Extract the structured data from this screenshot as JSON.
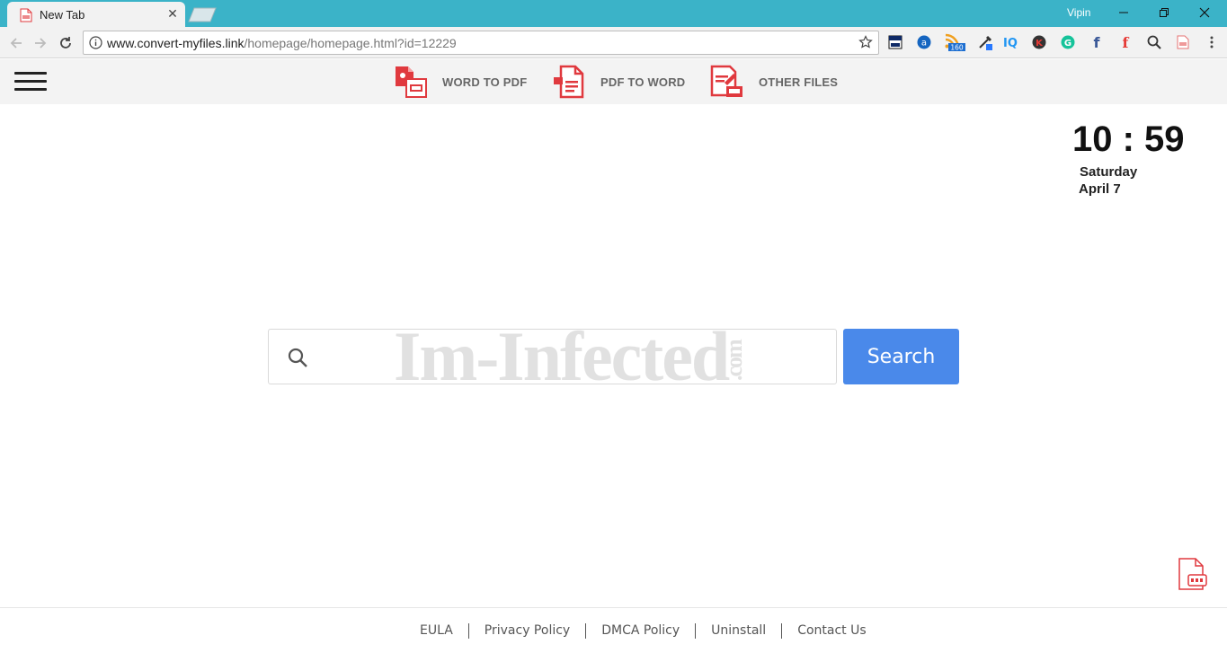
{
  "browser": {
    "tab_title": "New Tab",
    "tab_close": "✕",
    "profile_name": "Vipin",
    "url_host": "www.convert-myfiles.link",
    "url_path": "/homepage/homepage.html?id=12229",
    "extensions": [
      "window-icon",
      "a-icon",
      "rss-icon",
      "eyedropper-icon",
      "iq-icon",
      "k-icon",
      "grammarly-icon",
      "facebook-icon",
      "flipboard-icon",
      "magnifier-icon",
      "pdf-icon"
    ],
    "rss_badge": "160",
    "ext_iq_label": "IQ",
    "ext_k_label": "K",
    "ext_g_label": "G",
    "ext_f_label": "f",
    "ext_f2_label": "f",
    "ext_a_label": "a"
  },
  "header": {
    "nav": [
      {
        "label": "WORD TO PDF",
        "icon": "word-to-pdf-icon"
      },
      {
        "label": "PDF TO WORD",
        "icon": "pdf-to-word-icon"
      },
      {
        "label": "OTHER FILES",
        "icon": "other-files-icon"
      }
    ]
  },
  "clock": {
    "time": "10 : 59",
    "day": "Saturday",
    "date": "April 7"
  },
  "search": {
    "placeholder": "",
    "button_label": "Search",
    "watermark": "Im-Infected",
    "watermark_suffix": ".com"
  },
  "footer": {
    "links": [
      "EULA",
      "Privacy Policy",
      "DMCA Policy",
      "Uninstall",
      "Contact Us"
    ]
  },
  "colors": {
    "titlebar": "#3bb3c8",
    "search_button": "#4a89ea",
    "brand_red": "#e0393e"
  }
}
